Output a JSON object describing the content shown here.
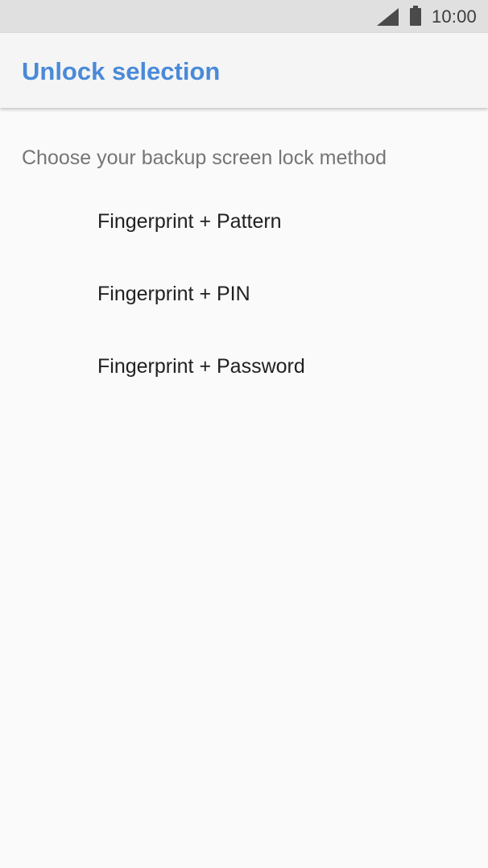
{
  "status_bar": {
    "time": "10:00",
    "icons": [
      "signal-icon",
      "battery-icon"
    ]
  },
  "app_bar": {
    "title": "Unlock selection",
    "title_color": "#4a8ad8"
  },
  "subtitle": "Choose your backup screen lock method",
  "options": [
    {
      "label": "Fingerprint + Pattern"
    },
    {
      "label": "Fingerprint + PIN"
    },
    {
      "label": "Fingerprint + Password"
    }
  ]
}
